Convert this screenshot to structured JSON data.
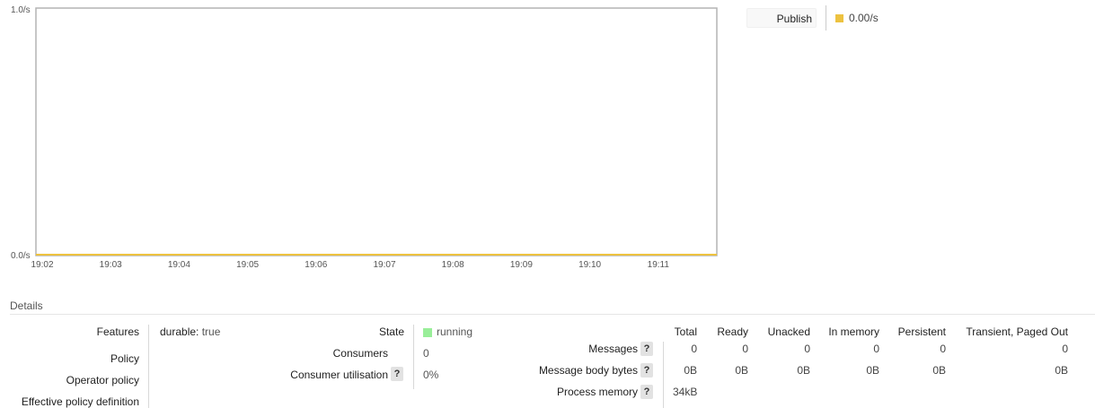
{
  "chart_data": {
    "type": "line",
    "x": [
      "19:02",
      "19:03",
      "19:04",
      "19:05",
      "19:06",
      "19:07",
      "19:08",
      "19:09",
      "19:10",
      "19:11"
    ],
    "series": [
      {
        "name": "Publish",
        "values": [
          0,
          0,
          0,
          0,
          0,
          0,
          0,
          0,
          0,
          0
        ],
        "color": "#edc240"
      }
    ],
    "ylim": [
      0,
      1
    ],
    "y_tick_labels": [
      "0.0/s",
      "1.0/s"
    ],
    "grid": false
  },
  "legend": {
    "label": "Publish",
    "value": "0.00/s",
    "color": "#edc240"
  },
  "details": {
    "heading": "Details",
    "features_label": "Features",
    "features_value_key": "durable:",
    "features_value": "true",
    "policy_label": "Policy",
    "operator_policy_label": "Operator policy",
    "effective_policy_label": "Effective policy definition",
    "state_label": "State",
    "state_value": "running",
    "state_color": "#99ee99",
    "consumers_label": "Consumers",
    "consumers_value": "0",
    "consumer_util_label": "Consumer utilisation",
    "consumer_util_value": "0%",
    "help_glyph": "?"
  },
  "stats": {
    "columns": [
      "Total",
      "Ready",
      "Unacked",
      "In memory",
      "Persistent",
      "Transient, Paged Out"
    ],
    "rows": [
      {
        "label": "Messages",
        "values": [
          "0",
          "0",
          "0",
          "0",
          "0",
          "0"
        ]
      },
      {
        "label": "Message body bytes",
        "values": [
          "0B",
          "0B",
          "0B",
          "0B",
          "0B",
          "0B"
        ]
      },
      {
        "label": "Process memory",
        "values": [
          "34kB"
        ]
      }
    ]
  }
}
